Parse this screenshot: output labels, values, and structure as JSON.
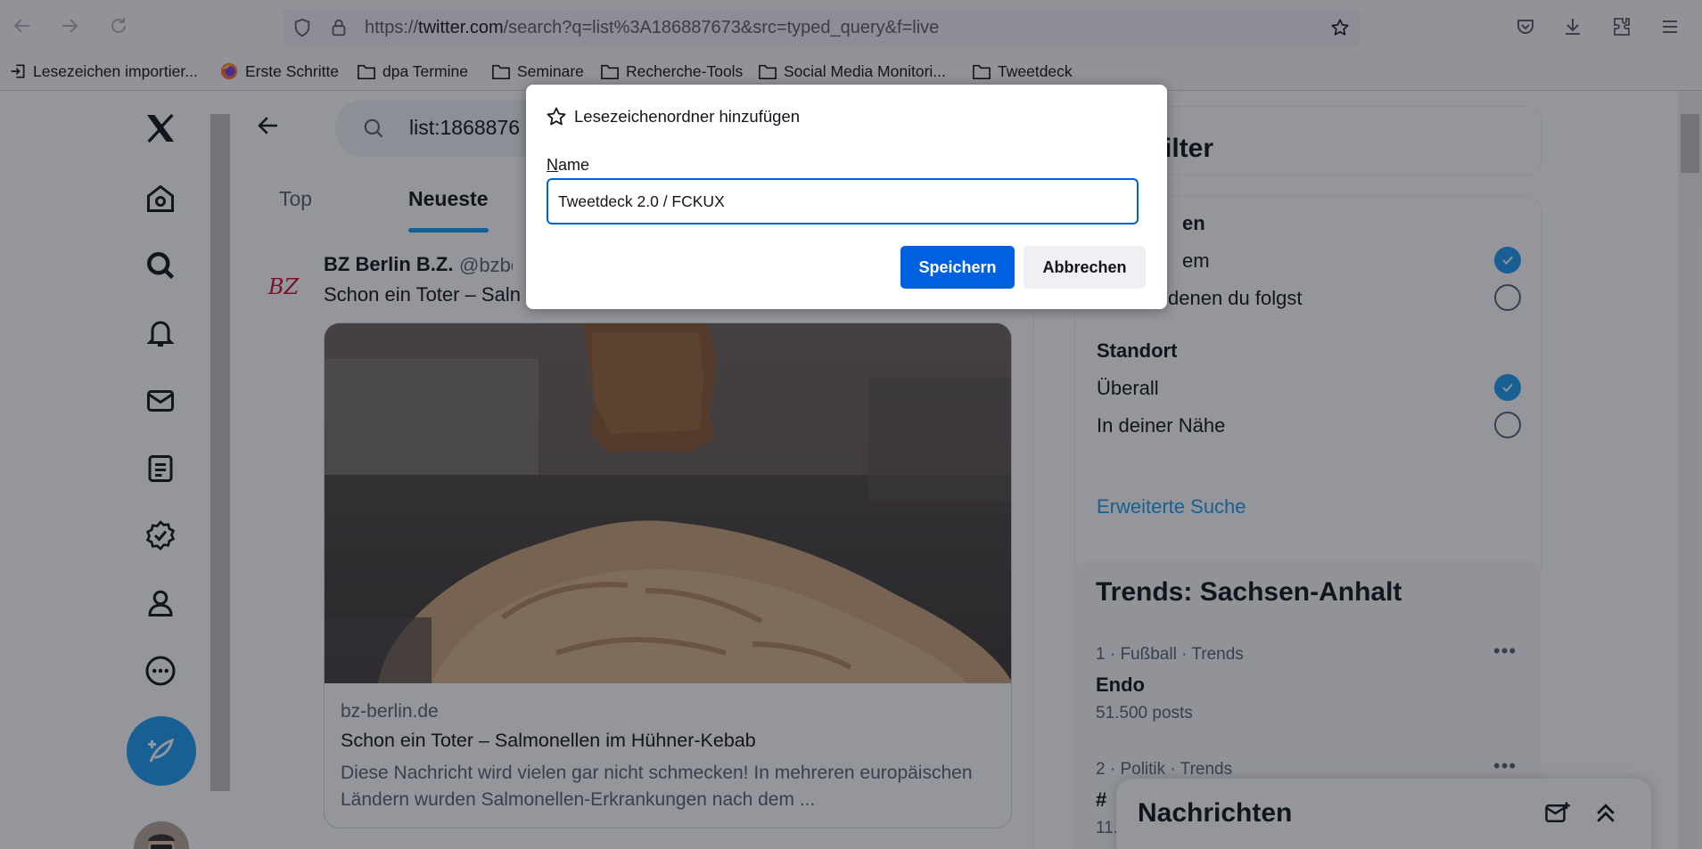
{
  "browser": {
    "url_prefix": "https://",
    "url_domain": "twitter.com",
    "url_path": "/search?q=list%3A186887673&src=typed_query&f=live",
    "icons": {
      "back": "arrow-left-icon",
      "forward": "arrow-right-icon",
      "reload": "reload-icon",
      "shield": "shield-icon",
      "lock": "lock-icon",
      "bookmark_star": "star-icon",
      "pocket": "pocket-icon",
      "downloads": "download-icon",
      "extensions": "puzzle-icon",
      "menu": "hamburger-icon"
    },
    "bookmarks": [
      "Lesezeichen importier...",
      "Erste Schritte",
      "dpa Termine",
      "Seminare",
      "Recherche-Tools",
      "Social Media Monitori...",
      "Tweetdeck"
    ]
  },
  "twitter": {
    "search_query": "list:1868876",
    "tabs": [
      "Top",
      "Neueste"
    ],
    "tweet": {
      "avatar_text": "BZ",
      "name": "BZ Berlin B.Z.",
      "handle": "@bzber",
      "text": "Schon ein Toter – Saln",
      "card": {
        "domain": "bz-berlin.de",
        "title": "Schon ein Toter – Salmonellen im Hühner-Kebab",
        "description": "Diese Nachricht wird vielen gar nicht schmecken! In mehreren europäischen Ländern wurden Salmonellen-Erkrankungen nach dem ..."
      }
    },
    "filter": {
      "title": "filter",
      "section1_head": "en",
      "option1": "em",
      "option2": "denen du folgst",
      "section2_head": "Standort",
      "option3": "Überall",
      "option4": "In deiner Nähe",
      "advanced_link": "Erweiterte Suche"
    },
    "trends": {
      "title": "Trends: Sachsen-Anhalt",
      "items": [
        {
          "meta": "1 · Fußball · Trends",
          "name": "Endo",
          "count": "51.500 posts"
        },
        {
          "meta": "2 · Politik · Trends",
          "name": "#",
          "count": "11."
        }
      ]
    },
    "messages_title": "Nachrichten",
    "colors": {
      "accent": "#1d9bf0",
      "text": "#0f1419",
      "muted": "#536471"
    }
  },
  "dialog": {
    "title": "Lesezeichenordner hinzufügen",
    "label_first": "N",
    "label_rest": "ame",
    "input_value": "Tweetdeck 2.0 / FCKUX",
    "save_label": "Speichern",
    "cancel_label": "Abbrechen",
    "colors": {
      "primary": "#0061e0"
    }
  }
}
